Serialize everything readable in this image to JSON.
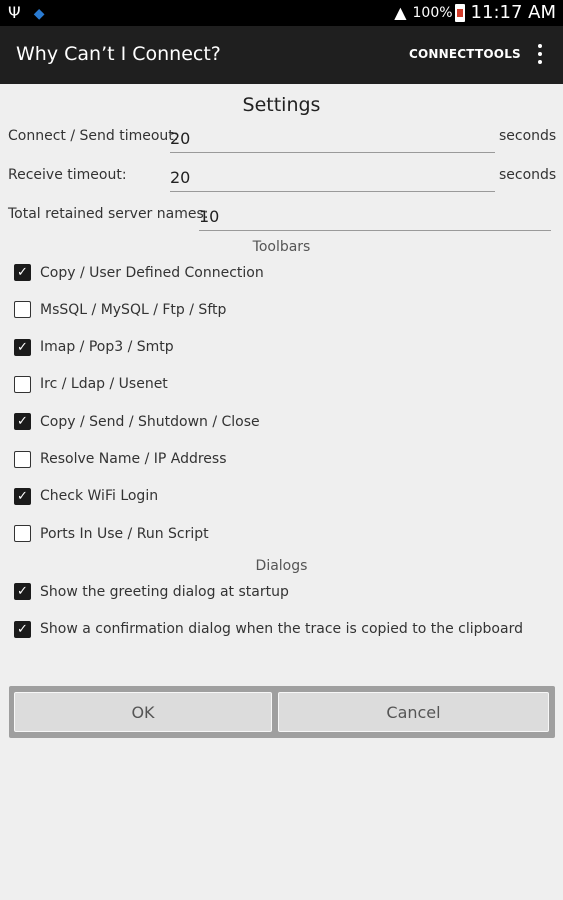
{
  "status": {
    "usb_icon": "usb-icon",
    "wifi_icon": "wifi-icon",
    "signal_icon": "signal-icon",
    "battery_pct": "100%",
    "time": "11:17 AM"
  },
  "app": {
    "title": "Why Can’t I Connect?",
    "actions": [
      "CONNECT",
      "TOOLS"
    ],
    "overflow_icon": "overflow-menu-icon"
  },
  "settings": {
    "title": "Settings",
    "connect_label": "Connect / Send timeout:",
    "connect_value": "20",
    "receive_label": "Receive timeout:",
    "receive_value": "20",
    "unit": "seconds",
    "retained_label": "Total retained server names:",
    "retained_value": "10",
    "toolbars_title": "Toolbars",
    "toolbars": [
      {
        "label": "Copy / User Defined Connection",
        "checked": true
      },
      {
        "label": "MsSQL / MySQL / Ftp / Sftp",
        "checked": false
      },
      {
        "label": "Imap / Pop3 / Smtp",
        "checked": true
      },
      {
        "label": "Irc / Ldap / Usenet",
        "checked": false
      },
      {
        "label": "Copy / Send / Shutdown / Close",
        "checked": true
      },
      {
        "label": "Resolve Name / IP Address",
        "checked": false
      },
      {
        "label": "Check WiFi Login",
        "checked": true
      },
      {
        "label": "Ports In Use / Run Script",
        "checked": false
      }
    ],
    "dialogs_title": "Dialogs",
    "dialogs": [
      {
        "label": "Show the greeting dialog at startup",
        "checked": true
      },
      {
        "label": "Show a confirmation dialog when the trace is copied to the clipboard",
        "checked": true
      }
    ]
  },
  "buttons": {
    "ok": "OK",
    "cancel": "Cancel"
  }
}
